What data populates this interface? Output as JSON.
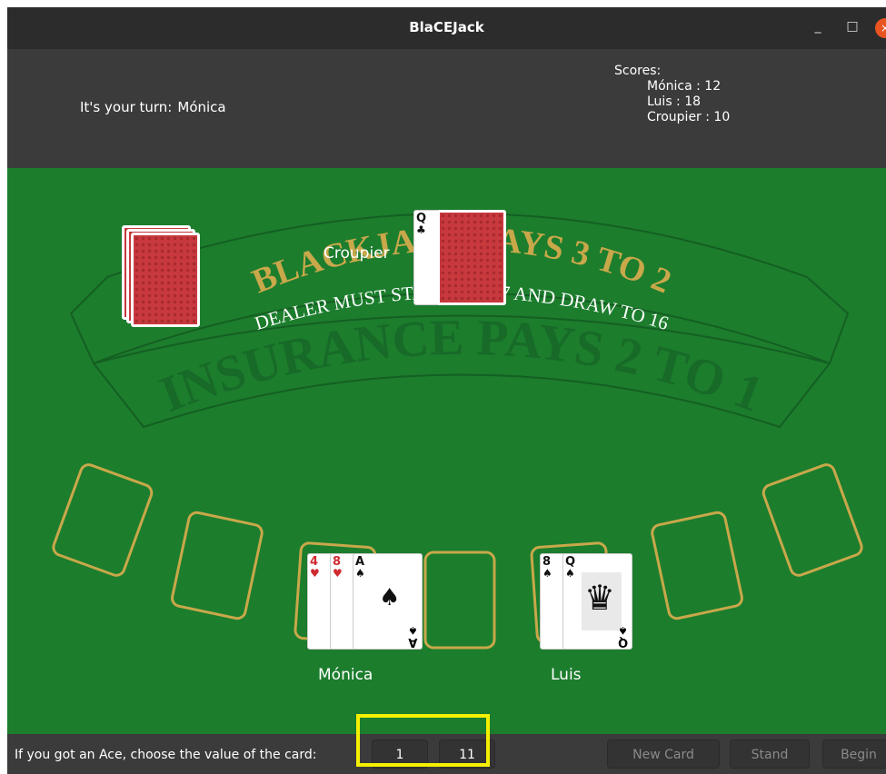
{
  "window": {
    "title": "BlaCEJack",
    "minimize": "_",
    "maximize": "□",
    "close": "×"
  },
  "header": {
    "turn_label": "It's your turn:",
    "current_player": "Mónica",
    "scores_title": "Scores:",
    "scores": [
      {
        "text": "Mónica : 12"
      },
      {
        "text": "Luis : 18"
      },
      {
        "text": "Croupier : 10"
      }
    ]
  },
  "table": {
    "banner_line1": "BLACKJACK PAYS 3 TO 2",
    "banner_line2": "DEALER MUST STAND ON 17 AND DRAW TO 16",
    "banner_line3": "INSURANCE PAYS 2 TO 1",
    "croupier_label": "Croupier",
    "croupier_card": {
      "rank": "Q",
      "suit": "♣"
    },
    "players": [
      {
        "name": "Mónica",
        "cards": [
          {
            "rank": "4",
            "suit": "♥"
          },
          {
            "rank": "8",
            "suit": "♥"
          },
          {
            "rank": "A",
            "suit": "♠"
          }
        ]
      },
      {
        "name": "Luis",
        "cards": [
          {
            "rank": "8",
            "suit": "♠"
          },
          {
            "rank": "Q",
            "suit": "♠"
          }
        ]
      }
    ],
    "ace_center": "♠",
    "ace_bottom": "A",
    "ace_bottom_suit": "♠",
    "queen_bottom": "Q",
    "queen_bottom_suit": "♠",
    "crown": "♛"
  },
  "footer": {
    "ace_prompt": "If you got an Ace, choose the value of the card:",
    "value_one": "1",
    "value_eleven": "11",
    "new_card": "New Card",
    "stand": "Stand",
    "begin": "Begin"
  },
  "colors": {
    "felt": "#1c7d2d",
    "gold": "#c8a84a",
    "highlight": "#f5f000"
  }
}
